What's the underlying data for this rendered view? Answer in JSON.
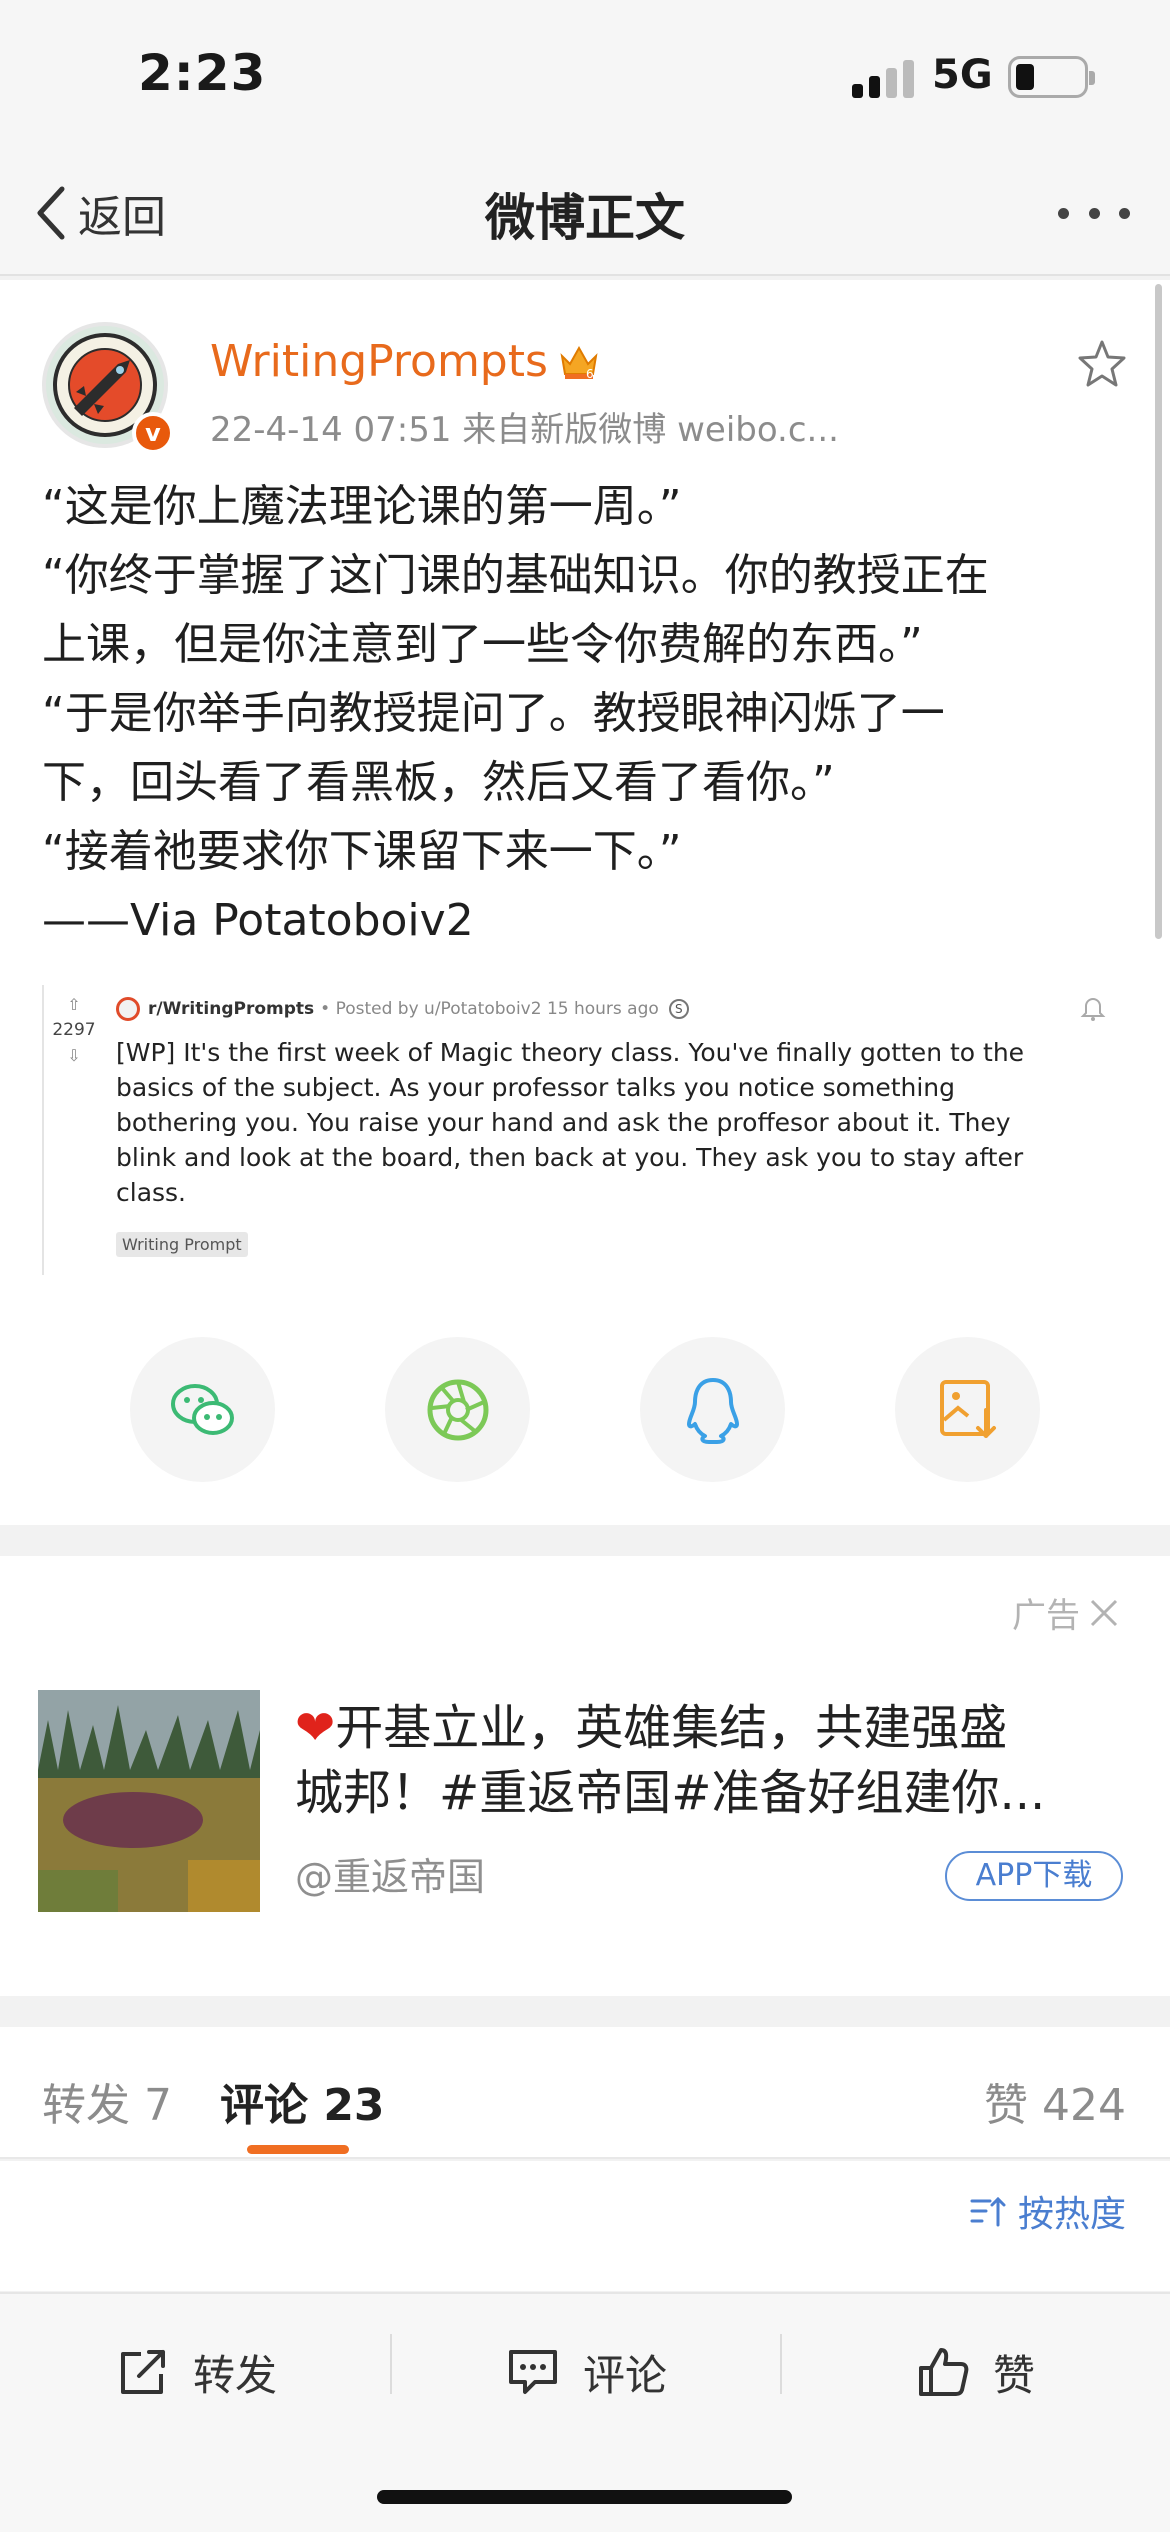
{
  "status_bar": {
    "time": "2:23",
    "network": "5G"
  },
  "nav": {
    "back_label": "返回",
    "title": "微博正文"
  },
  "post": {
    "username": "WritingPrompts",
    "meta": "22-4-14 07:51  来自新版微博 weibo.c...",
    "lines": [
      "“这是你上魔法理论课的第一周。”",
      "“你终于掌握了这门课的基础知识。你的教授正在",
      "上课，但是你注意到了一些令你费解的东西。”",
      "“于是你举手向教授提问了。教授眼神闪烁了一",
      "下，回头看了看黑板，然后又看了看你。”",
      "“接着祂要求你下课留下来一下。”",
      "——Via Potatoboiv2"
    ],
    "embed": {
      "subreddit": "r/WritingPrompts",
      "posted_by": "• Posted by u/Potatoboiv2 15 hours ago",
      "votes": "2297",
      "body_lines": [
        "[WP] It's the first week of Magic theory class. You've finally gotten to the",
        "basics of the subject. As your professor talks you notice something",
        "bothering you. You raise your hand and ask the proffesor about it. They",
        "blink and look at the board, then back at you. They ask you to stay after",
        "class."
      ],
      "flair": "Writing Prompt"
    }
  },
  "share": {
    "items": [
      {
        "icon": "wechat-icon",
        "color": "#3cba74"
      },
      {
        "icon": "moments-icon",
        "color": "#7cc957"
      },
      {
        "icon": "qq-icon",
        "color": "#3aa0e6"
      },
      {
        "icon": "save-image-icon",
        "color": "#f0a030"
      }
    ]
  },
  "ad": {
    "label": "广告",
    "title_line1": "开基立业，英雄集结，共建强盛",
    "title_line2": "城邦！#重返帝国#准备好组建你...",
    "heart": "❤",
    "account": "@重返帝国",
    "button": "APP下载"
  },
  "tabs": {
    "repost": "转发 7",
    "comment": "评论 23",
    "like": "赞 424"
  },
  "sort_label": "按热度",
  "toolbar": {
    "repost": "转发",
    "comment": "评论",
    "like": "赞"
  },
  "colors": {
    "accent_orange": "#f06e22",
    "username_orange": "#e86a1c",
    "link_blue": "#4a7ed0"
  }
}
